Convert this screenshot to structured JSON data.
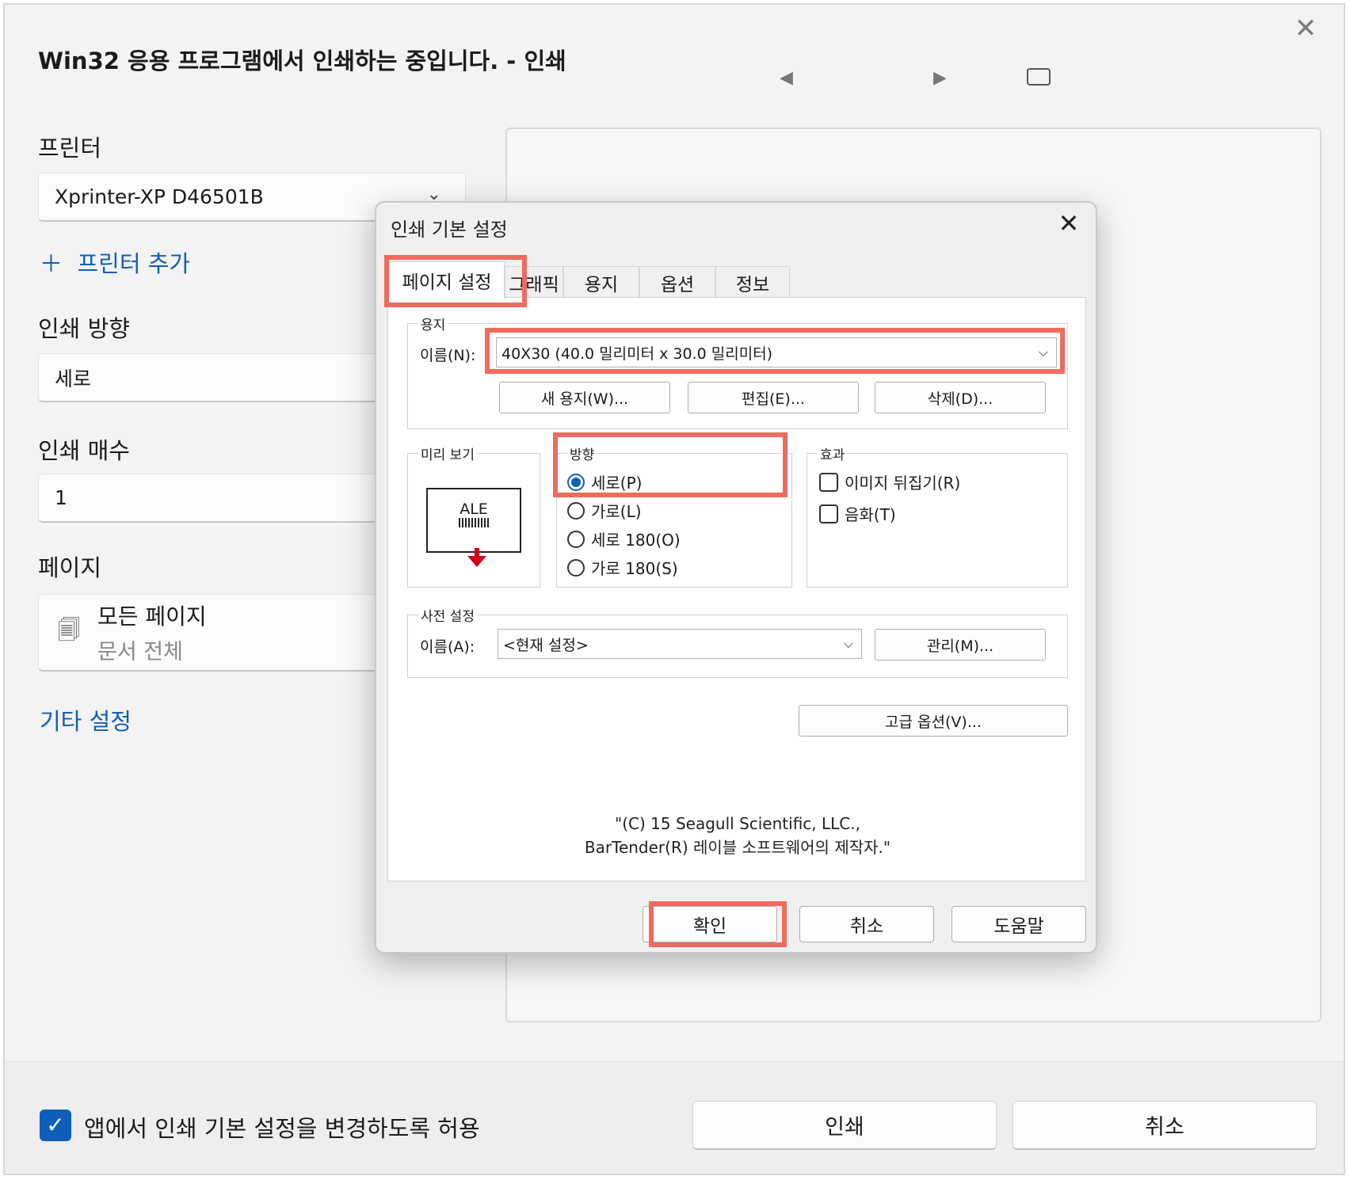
{
  "window": {
    "title": "Win32 응용 프로그램에서 인쇄하는 중입니다. - 인쇄",
    "close_icon": "close-icon"
  },
  "printer": {
    "label": "프린터",
    "value": "Xprinter-XP D46501B",
    "add_label": "프린터 추가"
  },
  "orientation": {
    "label": "인쇄 방향",
    "value": "세로"
  },
  "copies": {
    "label": "인쇄 매수",
    "value": "1"
  },
  "pages": {
    "label": "페이지",
    "value": "모든 페이지",
    "sub": "문서 전체"
  },
  "more_settings": "기타 설정",
  "footer": {
    "allow_label": "앱에서 인쇄 기본 설정을 변경하도록 허용",
    "print_button": "인쇄",
    "cancel_button": "취소"
  },
  "dialog": {
    "title": "인쇄 기본 설정",
    "tabs": [
      "페이지 설정",
      "그래픽",
      "용지",
      "옵션",
      "정보"
    ],
    "paper_group": "용지",
    "name_label": "이름(N):",
    "paper_value": "40X30 (40.0 밀리미터 x 30.0 밀리미터)",
    "new_button": "새 용지(W)...",
    "edit_button": "편집(E)...",
    "delete_button": "삭제(D)...",
    "preview_group": "미리 보기",
    "preview_text": "ALE",
    "orientation_group": "방향",
    "orientation_options": [
      "세로(P)",
      "가로(L)",
      "세로 180(O)",
      "가로 180(S)"
    ],
    "effects_group": "효과",
    "effects_options": [
      "이미지 뒤집기(R)",
      "음화(T)"
    ],
    "preset_group": "사전 설정",
    "preset_name_label": "이름(A):",
    "preset_value": "<현재 설정>",
    "manage_button": "관리(M)...",
    "advanced_button": "고급 옵션(V)...",
    "copyright_line1": "\"(C) 15 Seagull Scientific, LLC.,",
    "copyright_line2": "BarTender(R) 레이블 소프트웨어의 제작자.\"",
    "ok_button": "확인",
    "cancel_button": "취소",
    "help_button": "도움말"
  },
  "colors": {
    "accent": "#0f5fb8",
    "highlight": "#ef6b5e",
    "arrow_red": "#d0021b"
  }
}
